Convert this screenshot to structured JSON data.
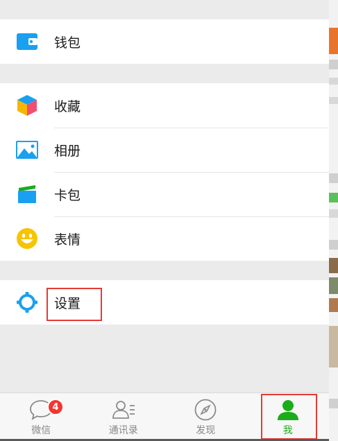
{
  "menu": {
    "wallet": "钱包",
    "favorites": "收藏",
    "album": "相册",
    "cards": "卡包",
    "stickers": "表情",
    "settings": "设置"
  },
  "tabbar": {
    "chats": "微信",
    "chats_badge": "4",
    "contacts": "通讯录",
    "discover": "发现",
    "me": "我"
  },
  "colors": {
    "accent": "#1aad19",
    "icon_blue": "#1aa0f0",
    "badge": "#f43530",
    "highlight": "#e53935"
  }
}
